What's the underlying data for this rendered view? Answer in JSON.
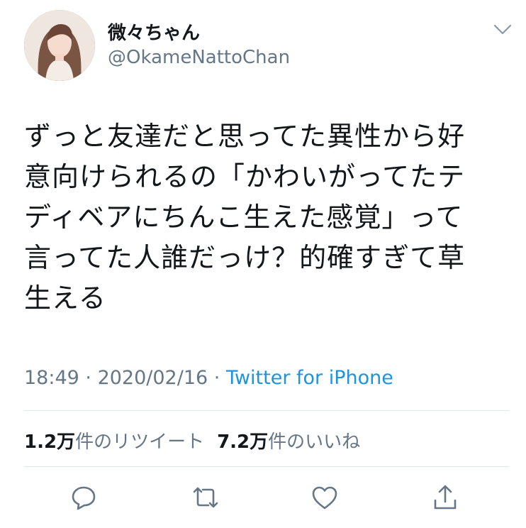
{
  "user": {
    "display_name": "微々ちゃん",
    "handle": "@OkameNattoChan"
  },
  "tweet": {
    "lines": [
      "ずっと友達だと思ってた異性から好",
      "意向けられるの「かわいがってたテ",
      "ディベアにちんこ生えた感覚」って",
      "言ってた人誰だっけ？的確すぎて草",
      "生える"
    ],
    "time": "18:49",
    "sep": " · ",
    "date": "2020/02/16",
    "source": "Twitter for iPhone"
  },
  "stats": {
    "retweets_count": "1.2万",
    "retweets_label": "件のリツイート",
    "likes_count": "7.2万",
    "likes_label": "件のいいね"
  },
  "icons": {
    "menu": "chevron-down-icon",
    "reply": "reply-icon",
    "retweet": "retweet-icon",
    "like": "heart-icon",
    "share": "share-icon"
  },
  "colors": {
    "text": "#14171a",
    "secondary": "#657786",
    "link": "#1b95e0",
    "divider": "#e1e8ed"
  }
}
